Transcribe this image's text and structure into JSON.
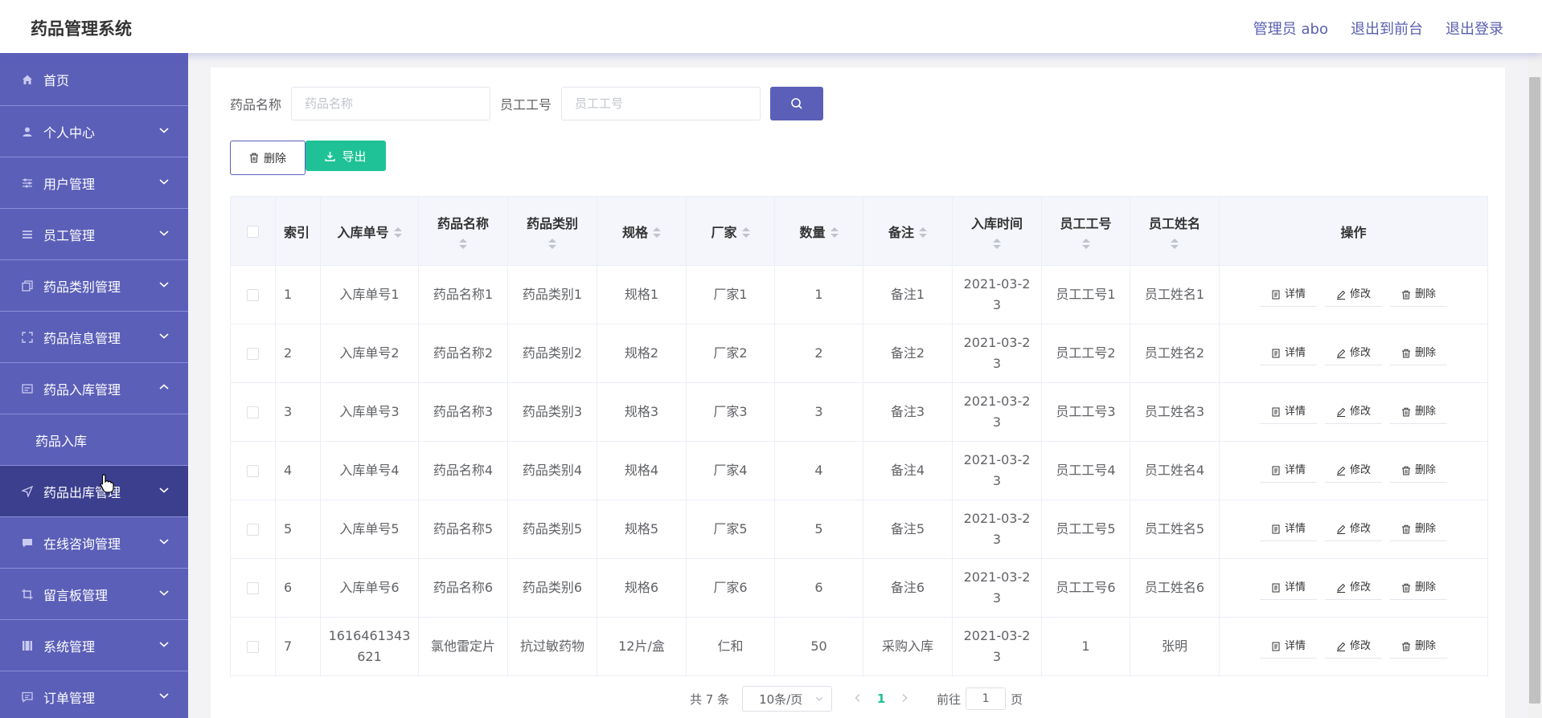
{
  "header": {
    "title": "药品管理系统",
    "user": "管理员 abo",
    "frontend_link": "退出到前台",
    "logout_link": "退出登录"
  },
  "sidebar": {
    "items": [
      {
        "label": "首页",
        "icon": "home-icon"
      },
      {
        "label": "个人中心",
        "icon": "user-icon"
      },
      {
        "label": "用户管理",
        "icon": "sliders-icon"
      },
      {
        "label": "员工管理",
        "icon": "list-icon"
      },
      {
        "label": "药品类别管理",
        "icon": "copy-icon"
      },
      {
        "label": "药品信息管理",
        "icon": "fullscreen-icon"
      },
      {
        "label": "药品入库管理",
        "icon": "monitor-icon",
        "expanded": true,
        "sub": "药品入库"
      },
      {
        "label": "药品出库管理",
        "icon": "send-icon",
        "active": true
      },
      {
        "label": "在线咨询管理",
        "icon": "chat-icon"
      },
      {
        "label": "留言板管理",
        "icon": "crop-icon"
      },
      {
        "label": "系统管理",
        "icon": "film-icon"
      },
      {
        "label": "订单管理",
        "icon": "message-icon"
      }
    ]
  },
  "search": {
    "name_label": "药品名称",
    "name_placeholder": "药品名称",
    "staff_label": "员工工号",
    "staff_placeholder": "员工工号"
  },
  "toolbar": {
    "delete_label": "删除",
    "export_label": "导出"
  },
  "table": {
    "columns": [
      "索引",
      "入库单号",
      "药品名称",
      "药品类别",
      "规格",
      "厂家",
      "数量",
      "备注",
      "入库时间",
      "员工工号",
      "员工姓名",
      "操作"
    ],
    "rows": [
      [
        "1",
        "入库单号1",
        "药品名称1",
        "药品类别1",
        "规格1",
        "厂家1",
        "1",
        "备注1",
        "2021-03-2\n3",
        "员工工号1",
        "员工姓名1"
      ],
      [
        "2",
        "入库单号2",
        "药品名称2",
        "药品类别2",
        "规格2",
        "厂家2",
        "2",
        "备注2",
        "2021-03-2\n3",
        "员工工号2",
        "员工姓名2"
      ],
      [
        "3",
        "入库单号3",
        "药品名称3",
        "药品类别3",
        "规格3",
        "厂家3",
        "3",
        "备注3",
        "2021-03-2\n3",
        "员工工号3",
        "员工姓名3"
      ],
      [
        "4",
        "入库单号4",
        "药品名称4",
        "药品类别4",
        "规格4",
        "厂家4",
        "4",
        "备注4",
        "2021-03-2\n3",
        "员工工号4",
        "员工姓名4"
      ],
      [
        "5",
        "入库单号5",
        "药品名称5",
        "药品类别5",
        "规格5",
        "厂家5",
        "5",
        "备注5",
        "2021-03-2\n3",
        "员工工号5",
        "员工姓名5"
      ],
      [
        "6",
        "入库单号6",
        "药品名称6",
        "药品类别6",
        "规格6",
        "厂家6",
        "6",
        "备注6",
        "2021-03-2\n3",
        "员工工号6",
        "员工姓名6"
      ],
      [
        "7",
        "1616461343\n621",
        "氯他雷定片",
        "抗过敏药物",
        "12片/盒",
        "仁和",
        "50",
        "采购入库",
        "2021-03-2\n3",
        "1",
        "张明"
      ]
    ],
    "actions": {
      "detail": "详情",
      "edit": "修改",
      "delete": "删除"
    }
  },
  "pagination": {
    "total": "共 7 条",
    "page_size": "10条/页",
    "current": "1",
    "goto_prefix": "前往",
    "goto_value": "1",
    "goto_suffix": "页"
  },
  "colors": {
    "accent": "#5b5fb8",
    "active_menu": "#3b3f8e",
    "export": "#1ec296"
  }
}
